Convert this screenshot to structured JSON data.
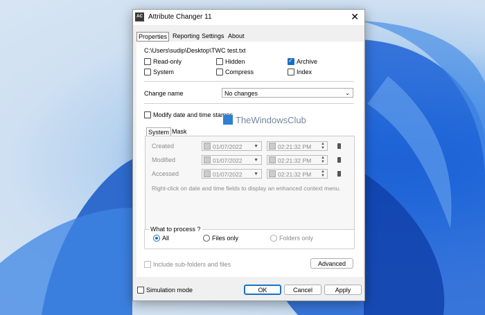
{
  "app": {
    "title": "Attribute Changer 11",
    "icon_text": "AC"
  },
  "tabs": [
    "Properties",
    "Reporting",
    "Settings",
    "About"
  ],
  "file_path": "C:\\Users\\sudip\\Desktop\\TWC test.txt",
  "attributes": {
    "read_only": {
      "label": "Read-only",
      "checked": false
    },
    "hidden": {
      "label": "Hidden",
      "checked": false
    },
    "archive": {
      "label": "Archive",
      "checked": true
    },
    "system": {
      "label": "System",
      "checked": false
    },
    "compress": {
      "label": "Compress",
      "checked": false
    },
    "index": {
      "label": "Index",
      "checked": false
    }
  },
  "change_name": {
    "label": "Change name",
    "value": "No changes"
  },
  "modify_dates": {
    "label": "Modify date and time stamps",
    "checked": false
  },
  "sub_tabs": [
    "System",
    "Mask"
  ],
  "date_rows": [
    {
      "label": "Created",
      "date": "01/07/2022",
      "time": "02:21:32  PM"
    },
    {
      "label": "Modified",
      "date": "01/07/2022",
      "time": "02:21:32  PM"
    },
    {
      "label": "Accessed",
      "date": "01/07/2022",
      "time": "02:21:32  PM"
    }
  ],
  "hint": "Right-click on date and time fields to display an enhanced context menu.",
  "process": {
    "label": "What to process ?",
    "options": [
      "All",
      "Files only",
      "Folders only"
    ],
    "selected": "All"
  },
  "include_sub": "Include sub-folders and files",
  "advanced_label": "Advanced",
  "simulation": "Simulation mode",
  "buttons": {
    "ok": "OK",
    "cancel": "Cancel",
    "apply": "Apply"
  },
  "watermark": "TheWindowsClub",
  "colors": {
    "accent": "#1a6fc4",
    "wallpaper": "#2d7be6"
  }
}
